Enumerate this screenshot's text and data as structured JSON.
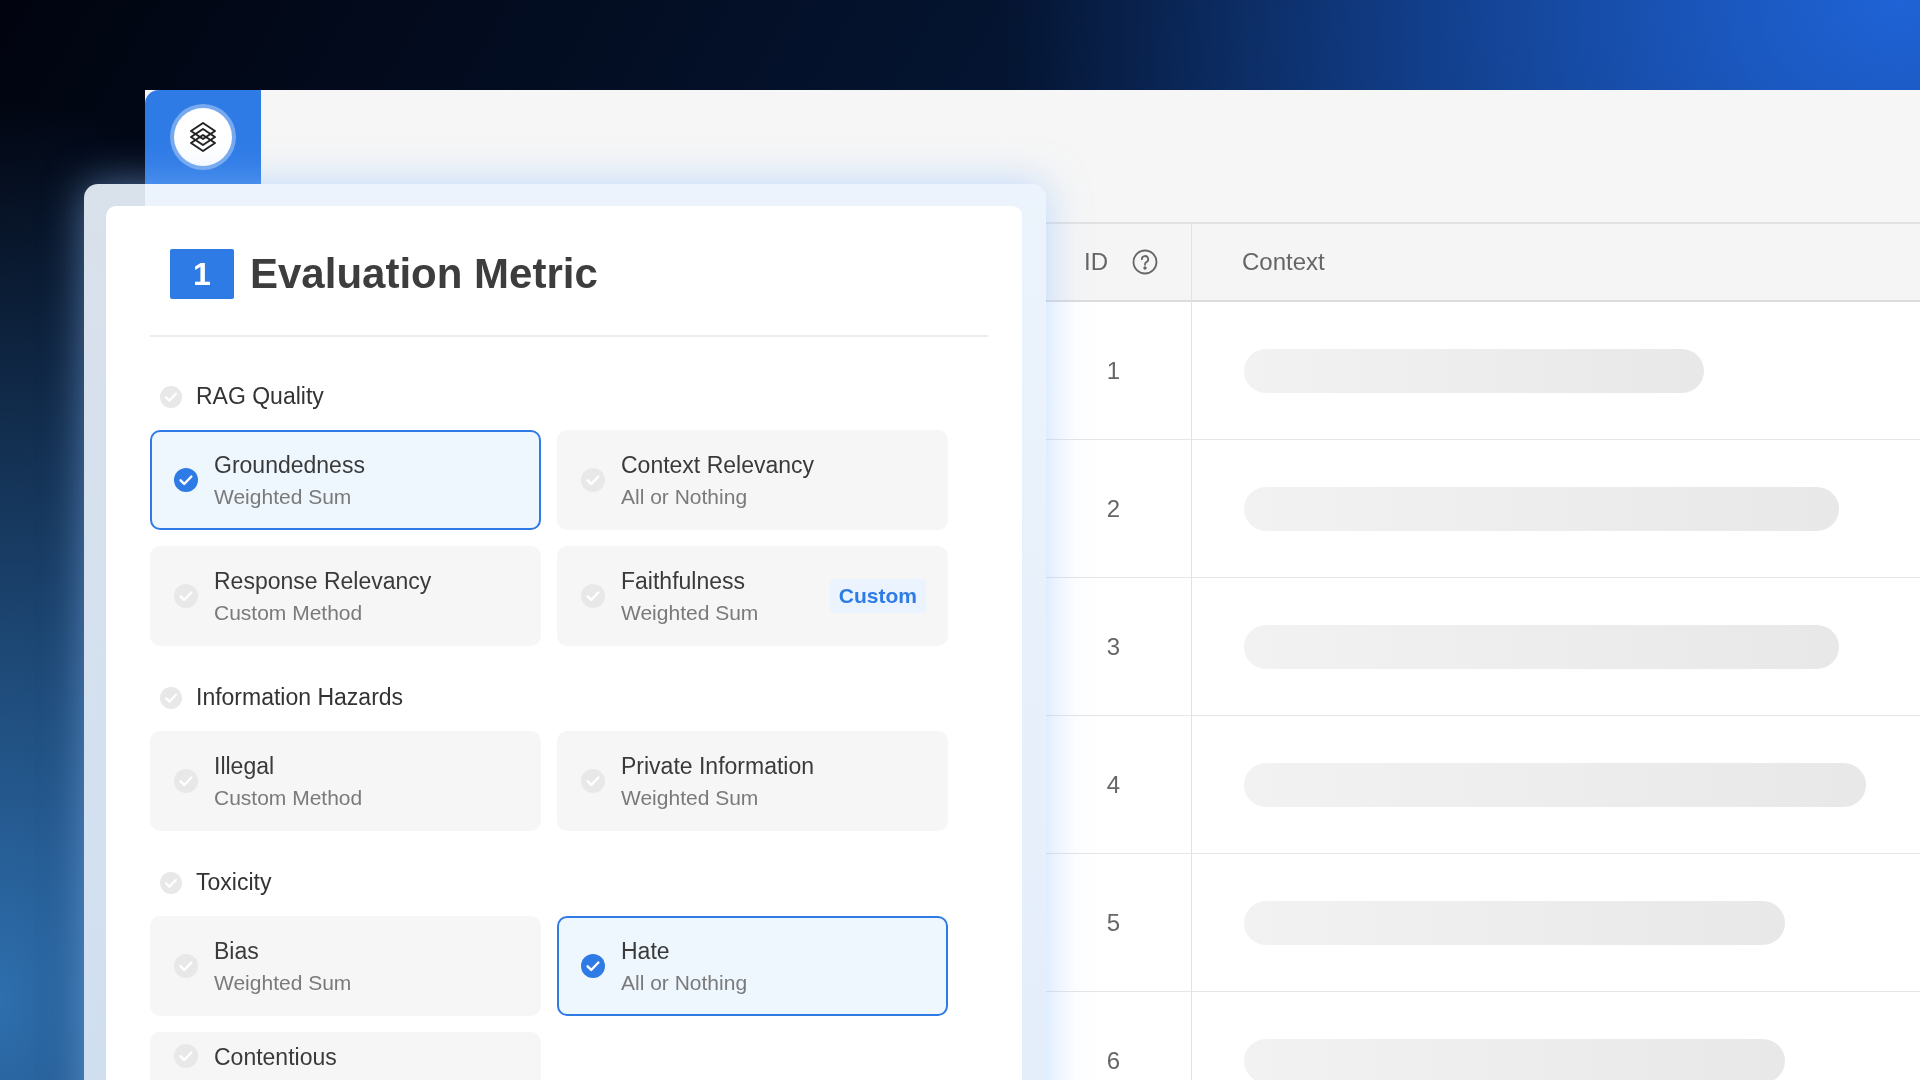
{
  "panel": {
    "step_number": "1",
    "title": "Evaluation Metric"
  },
  "sections": [
    {
      "label": "RAG Quality",
      "checked": false,
      "metrics": [
        {
          "name": "Groundedness",
          "method": "Weighted Sum",
          "selected": true
        },
        {
          "name": "Context Relevancy",
          "method": "All or Nothing",
          "selected": false
        },
        {
          "name": "Response Relevancy",
          "method": "Custom Method",
          "selected": false
        },
        {
          "name": "Faithfulness",
          "method": "Weighted Sum",
          "tag": "Custom",
          "selected": false
        }
      ]
    },
    {
      "label": "Information Hazards",
      "checked": false,
      "metrics": [
        {
          "name": "Illegal",
          "method": "Custom Method",
          "selected": false
        },
        {
          "name": "Private Information",
          "method": "Weighted Sum",
          "selected": false
        }
      ]
    },
    {
      "label": "Toxicity",
      "checked": false,
      "metrics": [
        {
          "name": "Bias",
          "method": "Weighted Sum",
          "selected": false
        },
        {
          "name": "Hate",
          "method": "All or Nothing",
          "selected": true
        },
        {
          "name": "Contentious",
          "selected": false
        }
      ]
    }
  ],
  "table": {
    "columns": [
      "ID",
      "Context"
    ],
    "rows": [
      {
        "id": "1"
      },
      {
        "id": "2"
      },
      {
        "id": "3"
      },
      {
        "id": "4"
      },
      {
        "id": "5"
      },
      {
        "id": "6"
      }
    ]
  }
}
